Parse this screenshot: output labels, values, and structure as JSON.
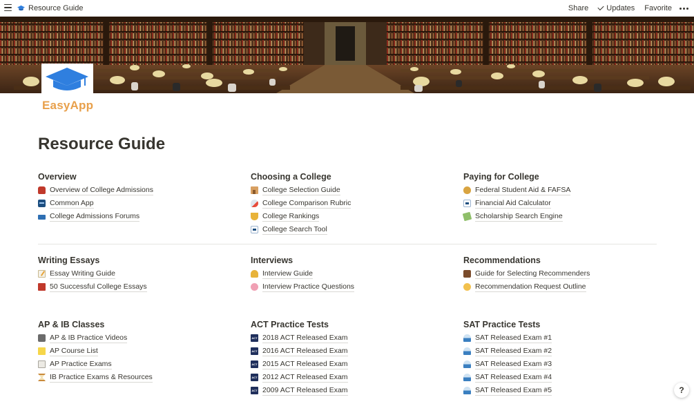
{
  "topbar": {
    "breadcrumb": "Resource Guide",
    "share": "Share",
    "updates": "Updates",
    "favorite": "Favorite"
  },
  "logo": {
    "text": "EasyApp",
    "color": "#e8a04b",
    "cap_color": "#2f7fdf"
  },
  "page": {
    "title": "Resource Guide"
  },
  "sections": [
    {
      "title": "Overview",
      "items": [
        {
          "label": "Overview of College Admissions",
          "icon": "backpack-icon"
        },
        {
          "label": "Common App",
          "icon": "common-app-icon"
        },
        {
          "label": "College Admissions Forums",
          "icon": "mobile-phone-icon"
        }
      ]
    },
    {
      "title": "Choosing a College",
      "items": [
        {
          "label": "College Selection Guide",
          "icon": "school-icon"
        },
        {
          "label": "College Comparison Rubric",
          "icon": "rocket-icon"
        },
        {
          "label": "College Rankings",
          "icon": "trophy-icon"
        },
        {
          "label": "College Search Tool",
          "icon": "college-board-icon"
        }
      ]
    },
    {
      "title": "Paying for College",
      "items": [
        {
          "label": "Federal Student Aid & FAFSA",
          "icon": "money-bag-icon"
        },
        {
          "label": "Financial Aid Calculator",
          "icon": "college-board-icon"
        },
        {
          "label": "Scholarship Search Engine",
          "icon": "flying-money-icon"
        }
      ]
    },
    {
      "title": "Writing Essays",
      "items": [
        {
          "label": "Essay Writing Guide",
          "icon": "memo-icon"
        },
        {
          "label": "50 Successful College Essays",
          "icon": "closed-book-icon"
        }
      ]
    },
    {
      "title": "Interviews",
      "items": [
        {
          "label": "Interview Guide",
          "icon": "person-icon"
        },
        {
          "label": "Interview Practice Questions",
          "icon": "brain-icon"
        }
      ]
    },
    {
      "title": "Recommendations",
      "items": [
        {
          "label": "Guide for Selecting Recommenders",
          "icon": "teacher-icon"
        },
        {
          "label": "Recommendation Request Outline",
          "icon": "handshake-icon"
        }
      ]
    },
    {
      "title": "AP & IB Classes",
      "items": [
        {
          "label": "AP & IB Practice Videos",
          "icon": "video-camera-icon"
        },
        {
          "label": "AP Course List",
          "icon": "sticky-note-icon"
        },
        {
          "label": "AP Practice Exams",
          "icon": "notepad-icon"
        },
        {
          "label": "IB Practice Exams & Resources",
          "icon": "hourglass-icon"
        }
      ]
    },
    {
      "title": "ACT Practice Tests",
      "items": [
        {
          "label": "2018 ACT Released Exam",
          "icon": "act-icon"
        },
        {
          "label": "2016 ACT Released Exam",
          "icon": "act-icon"
        },
        {
          "label": "2015 ACT Released Exam",
          "icon": "act-icon"
        },
        {
          "label": "2012 ACT Released Exam",
          "icon": "act-icon"
        },
        {
          "label": "2009 ACT Released Exam",
          "icon": "act-icon"
        }
      ]
    },
    {
      "title": "SAT Practice Tests",
      "items": [
        {
          "label": "SAT Released Exam #1",
          "icon": "sat-icon"
        },
        {
          "label": "SAT Released Exam #2",
          "icon": "sat-icon"
        },
        {
          "label": "SAT Released Exam #3",
          "icon": "sat-icon"
        },
        {
          "label": "SAT Released Exam #4",
          "icon": "sat-icon"
        },
        {
          "label": "SAT Released Exam #5",
          "icon": "sat-icon"
        }
      ]
    }
  ],
  "help": {
    "label": "?"
  }
}
